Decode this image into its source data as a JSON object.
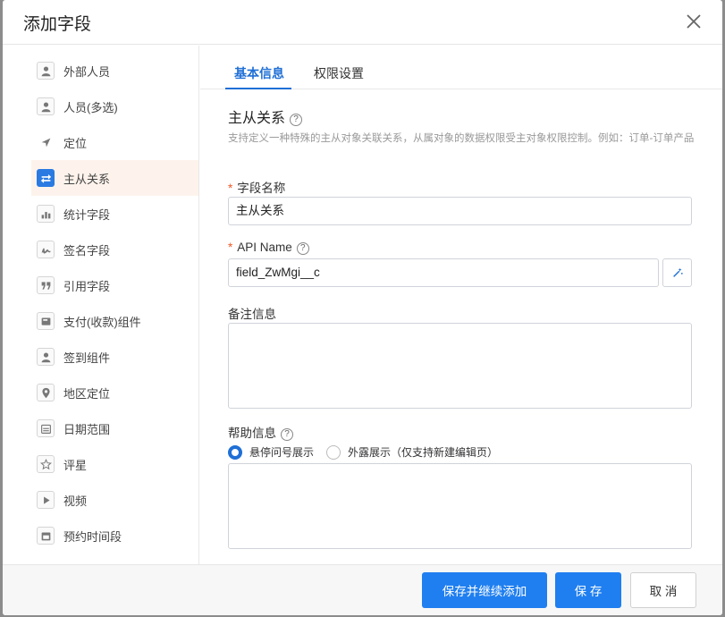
{
  "dialog": {
    "title": "添加字段"
  },
  "sidebar": {
    "items": [
      {
        "label": "外部人员",
        "icon": "person-icon"
      },
      {
        "label": "人员(多选)",
        "icon": "person-icon"
      },
      {
        "label": "定位",
        "icon": "location-arrow-icon"
      },
      {
        "label": "主从关系",
        "icon": "swap-arrows-icon",
        "active": true
      },
      {
        "label": "统计字段",
        "icon": "bar-chart-icon"
      },
      {
        "label": "签名字段",
        "icon": "signature-icon"
      },
      {
        "label": "引用字段",
        "icon": "quote-icon"
      },
      {
        "label": "支付(收款)组件",
        "icon": "wallet-icon"
      },
      {
        "label": "签到组件",
        "icon": "person-icon"
      },
      {
        "label": "地区定位",
        "icon": "map-pin-icon"
      },
      {
        "label": "日期范围",
        "icon": "calendar-icon"
      },
      {
        "label": "评星",
        "icon": "star-icon"
      },
      {
        "label": "视频",
        "icon": "video-play-icon"
      },
      {
        "label": "预约时间段",
        "icon": "calendar-icon"
      }
    ]
  },
  "tabs": [
    {
      "label": "基本信息",
      "active": true
    },
    {
      "label": "权限设置"
    }
  ],
  "form": {
    "section_title": "主从关系",
    "section_desc": "支持定义一种特殊的主从对象关联关系，从属对象的数据权限受主对象权限控制。例如：订单-订单产品",
    "required_mark": "*",
    "field_name_label": "字段名称",
    "field_name_value": "主从关系",
    "api_name_label": "API Name",
    "api_name_value": "field_ZwMgi__c",
    "remark_label": "备注信息",
    "help_label": "帮助信息",
    "help_options": [
      {
        "label": "悬停问号展示",
        "checked": true
      },
      {
        "label": "外露展示（仅支持新建编辑页）",
        "checked": false
      }
    ]
  },
  "footer": {
    "save_continue_label": "保存并继续添加",
    "save_label": "保 存",
    "cancel_label": "取 消"
  },
  "colors": {
    "primary": "#1f7ff0",
    "required": "#f05a28",
    "active_bg": "#fdf3ec"
  }
}
